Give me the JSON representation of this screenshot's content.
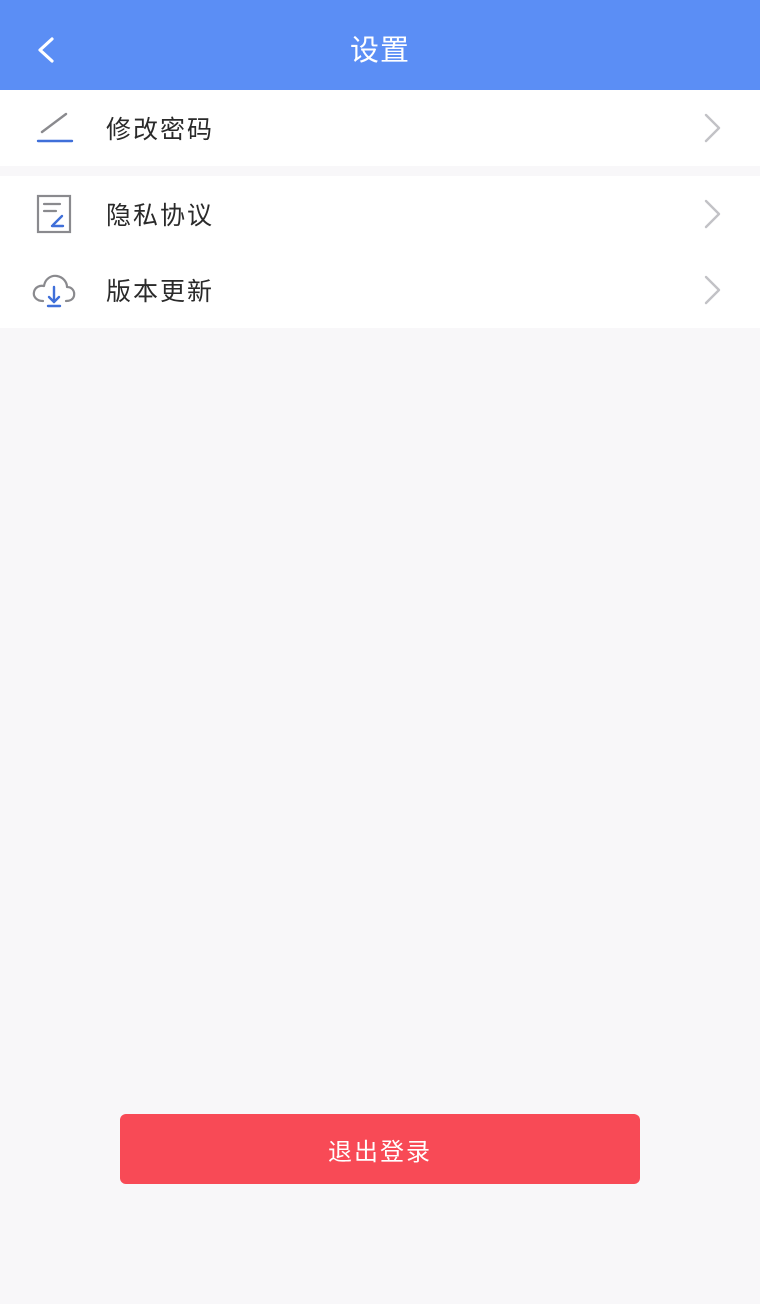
{
  "header": {
    "title": "设置",
    "back_icon": "back-chevron-icon"
  },
  "settings": {
    "items": [
      {
        "label": "修改密码",
        "icon": "edit-pen-icon"
      },
      {
        "label": "隐私协议",
        "icon": "document-edit-icon"
      },
      {
        "label": "版本更新",
        "icon": "cloud-download-icon"
      }
    ]
  },
  "logout": {
    "label": "退出登录"
  },
  "colors": {
    "header": "#5b8ef5",
    "background": "#f8f7f9",
    "logout": "#f84a56",
    "icon_accent": "#3f6fd9",
    "chevron": "#c2c2c6"
  }
}
